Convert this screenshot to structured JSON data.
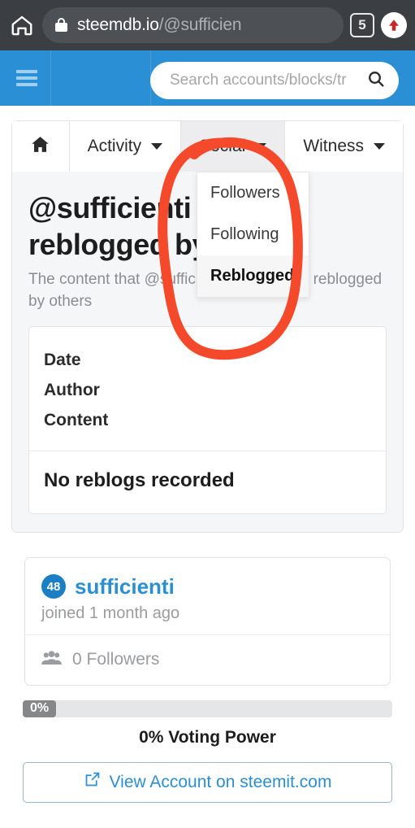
{
  "browser": {
    "home_icon": "home-icon",
    "lock_icon": "lock-icon",
    "url_domain": "steemdb.io",
    "url_path": "/@sufficien",
    "tab_count": "5",
    "upload_icon": "upload-arrow-icon"
  },
  "navbar": {
    "menu_icon": "hamburger-menu-icon",
    "search_placeholder": "Search accounts/blocks/tr",
    "search_value": "",
    "search_icon": "search-icon"
  },
  "tabs": {
    "home_icon": "house-icon",
    "items": [
      {
        "label": "Activity",
        "caret": "chevron-down-icon"
      },
      {
        "label": "Social",
        "caret": "chevron-down-icon"
      },
      {
        "label": "Witness",
        "caret": "chevron-down-icon"
      }
    ]
  },
  "dropdown": {
    "items": [
      {
        "label": "Followers",
        "selected": false
      },
      {
        "label": "Following",
        "selected": false
      },
      {
        "label": "Reblogged",
        "selected": true
      }
    ]
  },
  "page": {
    "heading": "@sufficienti recent reblogged by others",
    "subheading": "The content that @sufficienti posted, and reblogged by others"
  },
  "table": {
    "headers": [
      "Date",
      "Author",
      "Content"
    ],
    "empty_message": "No reblogs recorded"
  },
  "account": {
    "reputation": "48",
    "username": "sufficienti",
    "joined": "joined 1 month ago",
    "followers_icon": "users-icon",
    "followers": "0 Followers"
  },
  "voting": {
    "percent_label": "0%",
    "percent_value": 0,
    "caption": "0% Voting Power"
  },
  "footer": {
    "external_icon": "external-link-icon",
    "button_label": "View Account on steemit.com"
  },
  "annotation": {
    "shape": "hand-drawn-ellipse",
    "color": "#f4492a",
    "target": "social-dropdown"
  },
  "colors": {
    "brand_blue": "#2a8fd4",
    "chrome_dark": "#3b3e42",
    "annotation_red": "#f4492a"
  }
}
